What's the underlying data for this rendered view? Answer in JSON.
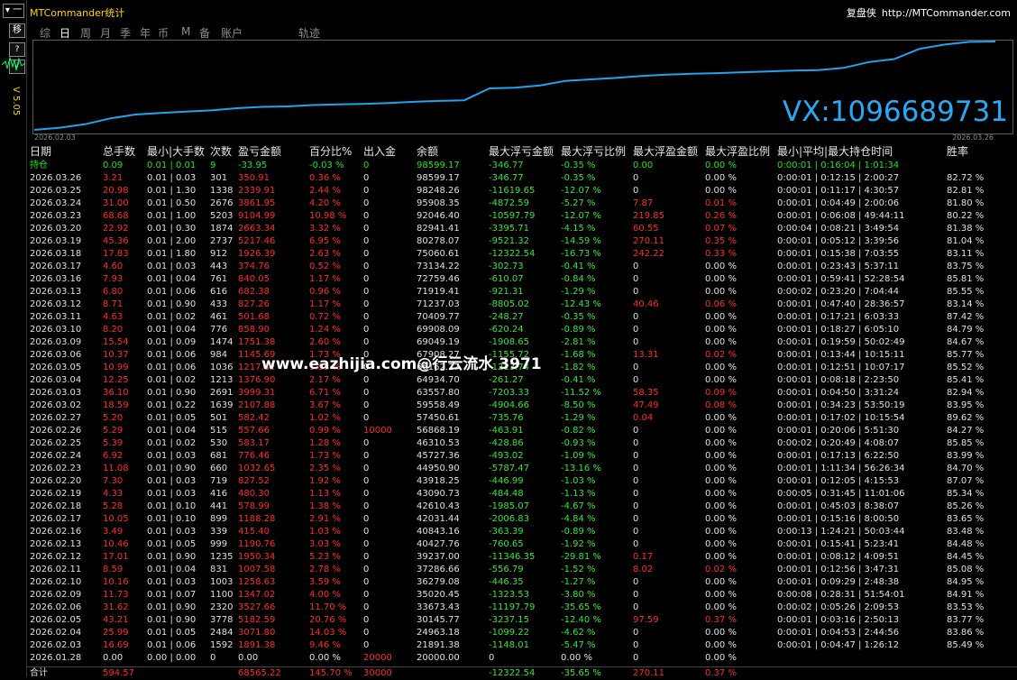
{
  "app": {
    "title": "MTCommander统计",
    "version": "V 5.05",
    "brand_name": "复盘侠",
    "brand_url": "http://MTCommander.com"
  },
  "left_buttons": [
    "移",
    "?",
    "√"
  ],
  "corner_label": "▾ 一",
  "tabs": [
    {
      "label": "综",
      "active": false
    },
    {
      "label": "日",
      "active": true
    },
    {
      "label": "周",
      "active": false
    },
    {
      "label": "月",
      "active": false
    },
    {
      "label": "季",
      "active": false
    },
    {
      "label": "年",
      "active": false
    },
    {
      "label": "币",
      "active": false
    },
    {
      "label": "M",
      "active": false
    },
    {
      "label": "备",
      "active": false
    },
    {
      "label": "账户",
      "active": false
    },
    {
      "label": "轨迹",
      "active": false
    }
  ],
  "chart_data": {
    "type": "line",
    "x_start": "2026.02.03",
    "x_end": "2026.03.26",
    "values": [
      20000.0,
      21891.38,
      24963.18,
      30145.77,
      33673.43,
      35020.45,
      36279.08,
      37286.66,
      39237.0,
      40427.76,
      40843.16,
      42031.44,
      42610.43,
      43090.73,
      43918.25,
      44950.9,
      45727.36,
      46310.53,
      56868.19,
      57450.61,
      59558.49,
      63557.8,
      64934.7,
      66162.27,
      67908.27,
      69049.19,
      69908.09,
      70409.77,
      71237.03,
      71919.41,
      72759.46,
      73134.22,
      75060.61,
      80278.07,
      82941.41,
      92046.4,
      95908.35,
      98248.26,
      98599.17
    ]
  },
  "overlay_text": "VX:1096689731",
  "watermark": "www.eazhijia.com@行云流水 3971",
  "columns": [
    "日期",
    "总手数",
    "最小|大手数",
    "次数",
    "盈亏金额",
    "百分比%",
    "出入金",
    "余额",
    "最大浮亏金额",
    "最大浮亏比例",
    "最大浮盈金额",
    "最大浮盈比例",
    "最小|平均|最大持仓时间",
    "胜率"
  ],
  "holding": [
    "持仓",
    "0.09",
    "0.01 | 0.01",
    "9",
    "-33.95",
    "-0.03 %",
    "0",
    "98599.17",
    "-346.77",
    "-0.35 %",
    "0.00",
    "0.00 %",
    "0:00:01 | 0:16:04 | 1:01:34",
    ""
  ],
  "rows": [
    [
      "2026.03.26",
      "3.21",
      "0.01 | 0.03",
      "301",
      "350.91",
      "0.36 %",
      "0",
      "98599.17",
      "-346.77",
      "-0.35 %",
      "0",
      "0.00 %",
      "0:00:01 | 0:12:15 | 2:00:27",
      "82.72 %"
    ],
    [
      "2026.03.25",
      "20.98",
      "0.01 | 1.30",
      "1338",
      "2339.91",
      "2.44 %",
      "0",
      "98248.26",
      "-11619.65",
      "-12.07 %",
      "0",
      "0.00 %",
      "0:00:01 | 0:11:17 | 4:30:57",
      "82.81 %"
    ],
    [
      "2026.03.24",
      "31.00",
      "0.01 | 0.50",
      "2676",
      "3861.95",
      "4.20 %",
      "0",
      "95908.35",
      "-4872.59",
      "-5.27 %",
      "7.87",
      "0.01 %",
      "0:00:01 | 0:04:49 | 2:00:06",
      "81.80 %"
    ],
    [
      "2026.03.23",
      "68.68",
      "0.01 | 1.00",
      "5203",
      "9104.99",
      "10.98 %",
      "0",
      "92046.40",
      "-10597.79",
      "-12.07 %",
      "219.85",
      "0.26 %",
      "0:00:01 | 0:06:08 | 49:44:11",
      "80.22 %"
    ],
    [
      "2026.03.20",
      "22.92",
      "0.01 | 0.30",
      "1874",
      "2663.34",
      "3.32 %",
      "0",
      "82941.41",
      "-3395.71",
      "-4.15 %",
      "60.55",
      "0.07 %",
      "0:00:04 | 0:08:21 | 3:49:54",
      "81.38 %"
    ],
    [
      "2026.03.19",
      "45.36",
      "0.01 | 2.00",
      "2737",
      "5217.46",
      "6.95 %",
      "0",
      "80278.07",
      "-9521.32",
      "-14.59 %",
      "270.11",
      "0.35 %",
      "0:00:01 | 0:05:12 | 3:39:56",
      "81.04 %"
    ],
    [
      "2026.03.18",
      "17.83",
      "0.01 | 1.80",
      "912",
      "1926.39",
      "2.63 %",
      "0",
      "75060.61",
      "-12322.54",
      "-16.73 %",
      "242.22",
      "0.33 %",
      "0:00:01 | 0:15:38 | 7:03:55",
      "83.11 %"
    ],
    [
      "2026.03.17",
      "4.60",
      "0.01 | 0.03",
      "443",
      "374.76",
      "0.52 %",
      "0",
      "73134.22",
      "-302.73",
      "-0.41 %",
      "0",
      "0.00 %",
      "0:00:01 | 0:23:43 | 5:37:11",
      "83.75 %"
    ],
    [
      "2026.03.16",
      "7.93",
      "0.01 | 0.04",
      "761",
      "840.05",
      "1.17 %",
      "0",
      "72759.46",
      "-610.07",
      "-0.84 %",
      "0",
      "0.00 %",
      "0:00:01 | 0:59:41 | 52:28:54",
      "85.81 %"
    ],
    [
      "2026.03.13",
      "6.80",
      "0.01 | 0.06",
      "616",
      "682.38",
      "0.96 %",
      "0",
      "71919.41",
      "-921.31",
      "-1.29 %",
      "0",
      "0.00 %",
      "0:00:02 | 0:23:20 | 7:04:44",
      "85.55 %"
    ],
    [
      "2026.03.12",
      "8.71",
      "0.01 | 0.90",
      "433",
      "827.26",
      "1.17 %",
      "0",
      "71237.03",
      "-8805.02",
      "-12.43 %",
      "40.46",
      "0.06 %",
      "0:00:01 | 0:47:40 | 28:36:57",
      "83.14 %"
    ],
    [
      "2026.03.11",
      "4.63",
      "0.01 | 0.02",
      "461",
      "501.68",
      "0.72 %",
      "0",
      "70409.77",
      "-248.27",
      "-0.35 %",
      "0",
      "0.00 %",
      "0:00:01 | 0:17:21 | 6:03:33",
      "87.42 %"
    ],
    [
      "2026.03.10",
      "8.20",
      "0.01 | 0.04",
      "776",
      "858.90",
      "1.24 %",
      "0",
      "69908.09",
      "-620.24",
      "-0.89 %",
      "0",
      "0.00 %",
      "0:00:01 | 0:18:27 | 6:05:10",
      "84.79 %"
    ],
    [
      "2026.03.09",
      "15.54",
      "0.01 | 0.09",
      "1474",
      "1751.38",
      "2.60 %",
      "0",
      "69049.19",
      "-1908.65",
      "-2.81 %",
      "0",
      "0.00 %",
      "0:00:01 | 0:19:59 | 50:02:49",
      "84.67 %"
    ],
    [
      "2026.03.06",
      "10.37",
      "0.01 | 0.06",
      "984",
      "1145.69",
      "1.73 %",
      "0",
      "67908.27",
      "-1155.72",
      "-1.68 %",
      "13.31",
      "0.02 %",
      "0:00:01 | 0:13:44 | 10:15:11",
      "85.77 %"
    ],
    [
      "2026.03.05",
      "10.99",
      "0.01 | 0.06",
      "1036",
      "1217.32",
      "1.85 %",
      "0",
      "66162.27",
      "-1213.74",
      "-1.82 %",
      "0",
      "0.00 %",
      "0:00:01 | 0:12:51 | 10:07:17",
      "85.52 %"
    ],
    [
      "2026.03.04",
      "12.25",
      "0.01 | 0.02",
      "1213",
      "1376.90",
      "2.17 %",
      "0",
      "64934.70",
      "-261.27",
      "-0.41 %",
      "0",
      "0.00 %",
      "0:00:01 | 0:08:18 | 2:23:50",
      "85.41 %"
    ],
    [
      "2026.03.03",
      "36.10",
      "0.01 | 0.90",
      "2691",
      "3999.31",
      "6.71 %",
      "0",
      "63557.80",
      "-7203.33",
      "-11.52 %",
      "58.35",
      "0.09 %",
      "0:00:01 | 0:04:50 | 3:31:24",
      "82.94 %"
    ],
    [
      "2026.03.02",
      "18.59",
      "0.01 | 0.22",
      "1639",
      "2107.88",
      "3.67 %",
      "0",
      "59558.49",
      "-4904.66",
      "-8.50 %",
      "47.49",
      "0.08 %",
      "0:00:01 | 0:34:23 | 53:50:19",
      "83.95 %"
    ],
    [
      "2026.02.27",
      "5.20",
      "0.01 | 0.05",
      "501",
      "582.42",
      "1.02 %",
      "0",
      "57450.61",
      "-735.76",
      "-1.29 %",
      "0.04",
      "0.00 %",
      "0:00:01 | 0:17:02 | 10:15:54",
      "89.62 %"
    ],
    [
      "2026.02.26",
      "5.29",
      "0.01 | 0.04",
      "515",
      "557.66",
      "0.99 %",
      "10000",
      "56868.19",
      "-463.91",
      "-0.82 %",
      "0",
      "0.00 %",
      "0:00:01 | 0:20:06 | 5:51:30",
      "84.27 %"
    ],
    [
      "2026.02.25",
      "5.39",
      "0.01 | 0.02",
      "530",
      "583.17",
      "1.28 %",
      "0",
      "46310.53",
      "-428.86",
      "-0.93 %",
      "0",
      "0.00 %",
      "0:00:02 | 0:20:49 | 4:08:07",
      "85.85 %"
    ],
    [
      "2026.02.24",
      "6.92",
      "0.01 | 0.03",
      "681",
      "776.46",
      "1.73 %",
      "0",
      "45727.36",
      "-493.02",
      "-1.09 %",
      "0",
      "0.00 %",
      "0:00:01 | 0:17:13 | 6:22:50",
      "83.99 %"
    ],
    [
      "2026.02.23",
      "11.08",
      "0.01 | 0.90",
      "660",
      "1032.65",
      "2.35 %",
      "0",
      "44950.90",
      "-5787.47",
      "-13.16 %",
      "0",
      "0.00 %",
      "0:00:01 | 1:11:34 | 56:26:34",
      "84.70 %"
    ],
    [
      "2026.02.20",
      "7.30",
      "0.01 | 0.03",
      "719",
      "827.52",
      "1.92 %",
      "0",
      "43918.25",
      "-446.99",
      "-1.03 %",
      "0",
      "0.00 %",
      "0:00:01 | 0:12:05 | 4:15:53",
      "87.07 %"
    ],
    [
      "2026.02.19",
      "4.33",
      "0.01 | 0.03",
      "416",
      "480.30",
      "1.13 %",
      "0",
      "43090.73",
      "-484.48",
      "-1.13 %",
      "0",
      "0.00 %",
      "0:00:05 | 0:31:45 | 11:01:06",
      "85.34 %"
    ],
    [
      "2026.02.18",
      "5.28",
      "0.01 | 0.10",
      "441",
      "578.99",
      "1.38 %",
      "0",
      "42610.43",
      "-1985.07",
      "-4.67 %",
      "0",
      "0.00 %",
      "0:00:01 | 0:45:03 | 8:38:07",
      "85.26 %"
    ],
    [
      "2026.02.17",
      "10.05",
      "0.01 | 0.10",
      "899",
      "1188.28",
      "2.91 %",
      "0",
      "42031.44",
      "-2006.83",
      "-4.84 %",
      "0",
      "0.00 %",
      "0:00:01 | 0:15:16 | 8:00:50",
      "83.65 %"
    ],
    [
      "2026.02.16",
      "3.49",
      "0.01 | 0.03",
      "339",
      "415.40",
      "1.03 %",
      "0",
      "40843.16",
      "-363.39",
      "-0.89 %",
      "0",
      "0.00 %",
      "0:00:13 | 1:24:21 | 50:03:44",
      "83.48 %"
    ],
    [
      "2026.02.13",
      "10.46",
      "0.01 | 0.05",
      "999",
      "1190.76",
      "3.03 %",
      "0",
      "40427.76",
      "-760.65",
      "-1.92 %",
      "0",
      "0.00 %",
      "0:00:01 | 0:15:41 | 5:23:41",
      "84.48 %"
    ],
    [
      "2026.02.12",
      "17.01",
      "0.01 | 0.90",
      "1235",
      "1950.34",
      "5.23 %",
      "0",
      "39237.00",
      "-11346.35",
      "-29.81 %",
      "0.17",
      "0.00 %",
      "0:00:01 | 0:08:12 | 4:09:51",
      "84.45 %"
    ],
    [
      "2026.02.11",
      "8.59",
      "0.01 | 0.04",
      "831",
      "1007.58",
      "2.78 %",
      "0",
      "37286.66",
      "-556.79",
      "-1.52 %",
      "8.02",
      "0.02 %",
      "0:00:01 | 0:12:56 | 3:47:31",
      "85.08 %"
    ],
    [
      "2026.02.10",
      "10.16",
      "0.01 | 0.03",
      "1003",
      "1258.63",
      "3.59 %",
      "0",
      "36279.08",
      "-446.35",
      "-1.27 %",
      "0",
      "0.00 %",
      "0:00:01 | 0:09:29 | 2:48:38",
      "84.95 %"
    ],
    [
      "2026.02.09",
      "11.73",
      "0.01 | 0.07",
      "1100",
      "1347.02",
      "4.00 %",
      "0",
      "35020.45",
      "-1323.53",
      "-3.80 %",
      "0",
      "0.00 %",
      "0:00:08 | 0:28:31 | 51:54:01",
      "84.91 %"
    ],
    [
      "2026.02.06",
      "31.62",
      "0.01 | 0.90",
      "2320",
      "3527.66",
      "11.70 %",
      "0",
      "33673.43",
      "-11197.79",
      "-35.65 %",
      "0",
      "0.00 %",
      "0:00:02 | 0:05:26 | 2:09:53",
      "83.53 %"
    ],
    [
      "2026.02.05",
      "43.21",
      "0.01 | 0.90",
      "3778",
      "5182.59",
      "20.76 %",
      "0",
      "30145.77",
      "-3237.15",
      "-12.40 %",
      "97.59",
      "0.37 %",
      "0:00:01 | 0:03:16 | 2:50:13",
      "83.77 %"
    ],
    [
      "2026.02.04",
      "25.99",
      "0.01 | 0.05",
      "2484",
      "3071.80",
      "14.03 %",
      "0",
      "24963.18",
      "-1099.22",
      "-4.62 %",
      "0",
      "0.00 %",
      "0:00:01 | 0:04:53 | 2:44:56",
      "83.86 %"
    ],
    [
      "2026.02.03",
      "16.69",
      "0.01 | 0.06",
      "1592",
      "1891.38",
      "9.46 %",
      "0",
      "21891.38",
      "-1148.01",
      "-5.47 %",
      "0",
      "0.00 %",
      "0:00:01 | 0:04:47 | 1:26:12",
      "85.49 %"
    ],
    [
      "2026.01.28",
      "0.00",
      "0.00 | 0.00",
      "0",
      "0.00",
      "0.00 %",
      "20000",
      "20000.00",
      "0",
      "0.00 %",
      "0",
      "0.00 %",
      "",
      ""
    ]
  ],
  "total": [
    "合计",
    "594.57",
    "",
    "",
    "68565.22",
    "145.70 %",
    "30000",
    "",
    "-12322.54",
    "-35.65 %",
    "270.11",
    "0.37 %",
    "",
    ""
  ],
  "colors": {
    "profit": "#ff2a2a",
    "loss": "#33e633",
    "holding": "#19e619",
    "line": "#1ea4f0",
    "accent": "#ffd400",
    "vx": "#29a9f5"
  }
}
